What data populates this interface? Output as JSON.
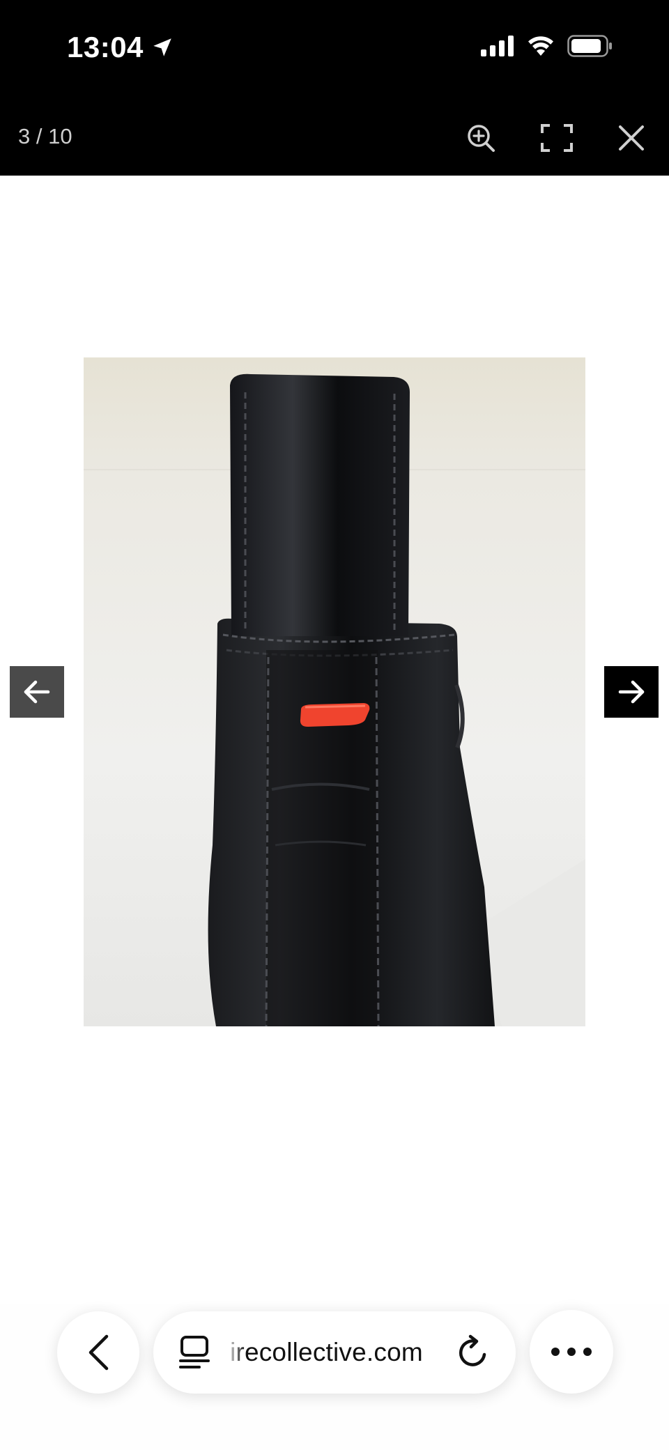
{
  "status_bar": {
    "time": "13:04"
  },
  "viewer": {
    "counter": "3 / 10"
  },
  "browser": {
    "url": "irecollective.com"
  },
  "colors": {
    "status_bg": "#000000",
    "viewer_bg": "#000000",
    "prev_arrow_bg": "#4a4a4a",
    "next_arrow_bg": "#000000",
    "leather": "#141517",
    "tab_accent": "#f0442e"
  },
  "icons": {
    "location": "location-arrow-icon",
    "signal": "cellular-signal-icon",
    "wifi": "wifi-icon",
    "battery": "battery-icon",
    "zoom": "zoom-in-icon",
    "fullscreen": "fullscreen-icon",
    "close": "close-icon",
    "prev": "arrow-left-icon",
    "next": "arrow-right-icon",
    "back": "chevron-left-icon",
    "tabs": "tabs-icon",
    "reload": "reload-icon",
    "more": "more-icon"
  }
}
